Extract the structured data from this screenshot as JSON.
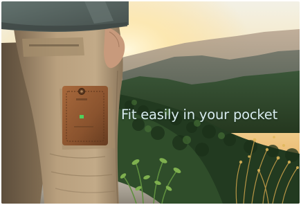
{
  "banner": {
    "headline": "Fit easily in your pocket",
    "headline_color": "#d8ecef"
  },
  "photo": {
    "subject": "pocket-device-in-cargo-pants",
    "setting": "mountain-sunset",
    "colors": {
      "sky": "#f2d9a0",
      "sun": "#fff3cc",
      "pants": "#b39a78",
      "device": "#8f5a34",
      "shirt": "#5b6a67",
      "forest": "#2c4a2f"
    }
  }
}
